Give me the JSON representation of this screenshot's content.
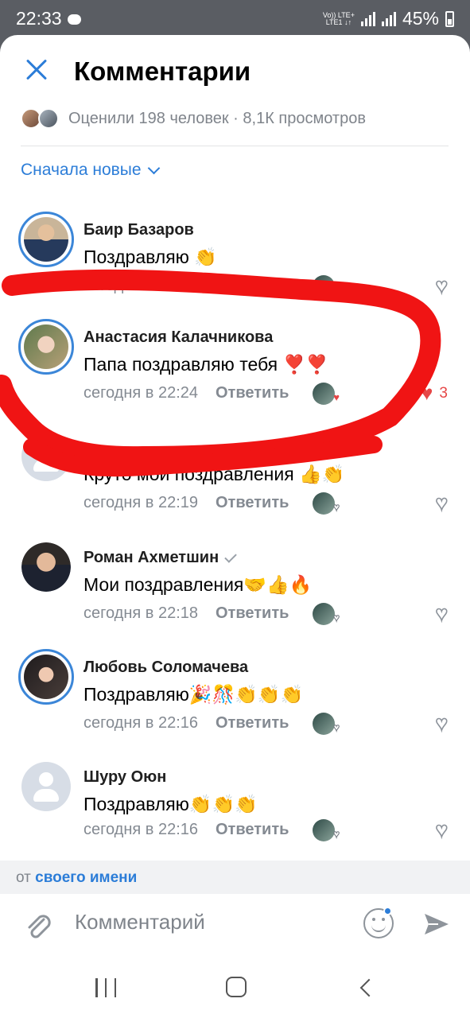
{
  "status_bar": {
    "time": "22:33",
    "network_top": "Vo)) LTE+",
    "network_bottom": "LTE1 ↓↑",
    "battery": "45%"
  },
  "header": {
    "title": "Комментарии"
  },
  "likes_summary": "Оценили 198 человек · 8,1К просмотров",
  "sort_label": "Сначала новые",
  "comments": [
    {
      "name": "Баир Базаров",
      "text": "Поздравляю 👏",
      "time": "сегодня в 22:31",
      "reply": "Ответить",
      "liked": false,
      "like_count": ""
    },
    {
      "name": "Анастасия Калачникова",
      "text": "Папа поздравляю тебя ❣️❣️",
      "time": "сегодня в 22:24",
      "reply": "Ответить",
      "liked": true,
      "like_count": "3"
    },
    {
      "name": "",
      "text": "Круто мои поздравления 👍👏",
      "time": "сегодня в 22:19",
      "reply": "Ответить",
      "liked": false,
      "like_count": ""
    },
    {
      "name": "Роман Ахметшин",
      "text": "Мои поздравления🤝👍🔥",
      "time": "сегодня в 22:18",
      "reply": "Ответить",
      "liked": false,
      "like_count": "",
      "verified": true
    },
    {
      "name": "Любовь Соломачева",
      "text": "Поздравляю🎉🎊👏👏👏",
      "time": "сегодня в 22:16",
      "reply": "Ответить",
      "liked": false,
      "like_count": ""
    },
    {
      "name": "Шуру Оюн",
      "text": "Поздравляю👏👏👏",
      "time": "сегодня в 22:16",
      "reply": "Ответить",
      "liked": false,
      "like_count": ""
    }
  ],
  "from_bar": {
    "prefix": "от",
    "link": "своего имени"
  },
  "input": {
    "placeholder": "Комментарий"
  },
  "colors": {
    "accent": "#2c7dd8",
    "like": "#e64646",
    "scribble": "#f01414"
  }
}
